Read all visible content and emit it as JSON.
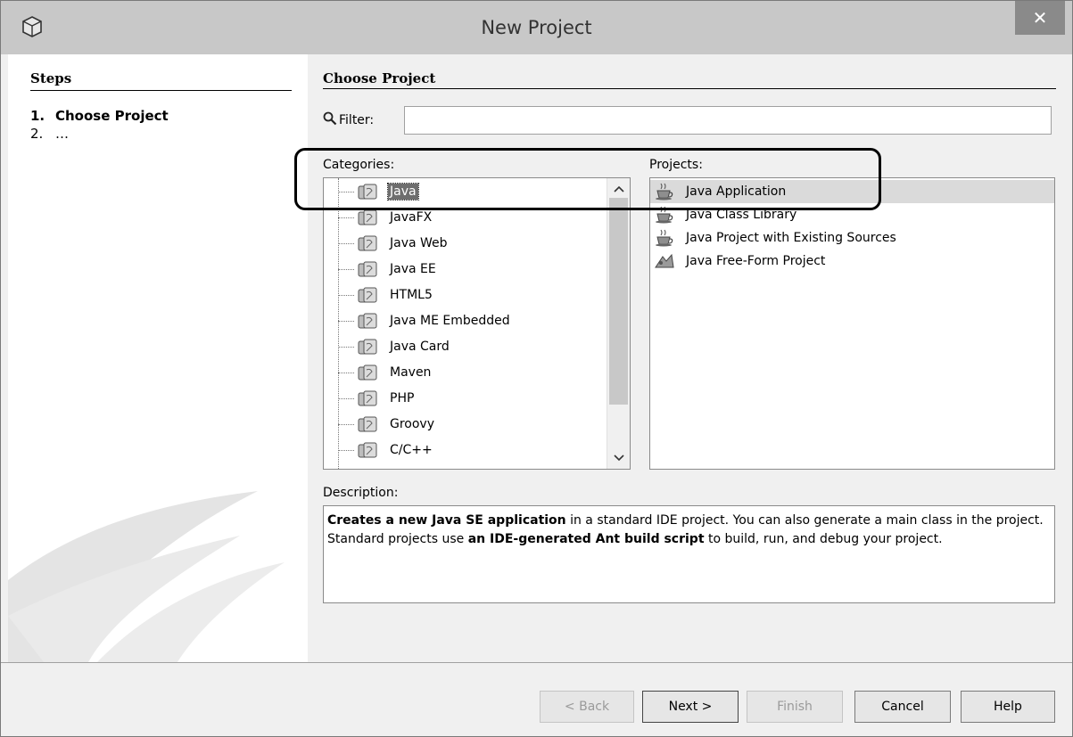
{
  "window": {
    "title": "New Project",
    "close_label": "✕"
  },
  "steps": {
    "title": "Steps",
    "items": [
      {
        "num": "1.",
        "label": "Choose Project"
      },
      {
        "num": "2.",
        "label": "…"
      }
    ]
  },
  "panel": {
    "title": "Choose Project"
  },
  "filter": {
    "label": "Filter:",
    "value": ""
  },
  "categories": {
    "label": "Categories:",
    "items": [
      "Java",
      "JavaFX",
      "Java Web",
      "Java EE",
      "HTML5",
      "Java ME Embedded",
      "Java Card",
      "Maven",
      "PHP",
      "Groovy",
      "C/C++"
    ],
    "selected": "Java"
  },
  "projects": {
    "label": "Projects:",
    "items": [
      "Java Application",
      "Java Class Library",
      "Java Project with Existing Sources",
      "Java Free-Form Project"
    ],
    "selected": "Java Application"
  },
  "description": {
    "label": "Description:",
    "part1_bold": "Creates a new Java SE application",
    "part2": " in a standard IDE project. You can also generate a main class in the project. Standard projects use ",
    "part3_bold": "an IDE-generated Ant build script",
    "part4": " to build, run, and debug your project."
  },
  "buttons": {
    "back": "< Back",
    "next": "Next >",
    "finish": "Finish",
    "cancel": "Cancel",
    "help": "Help"
  },
  "scroll": {
    "up": "^",
    "down": "v"
  }
}
